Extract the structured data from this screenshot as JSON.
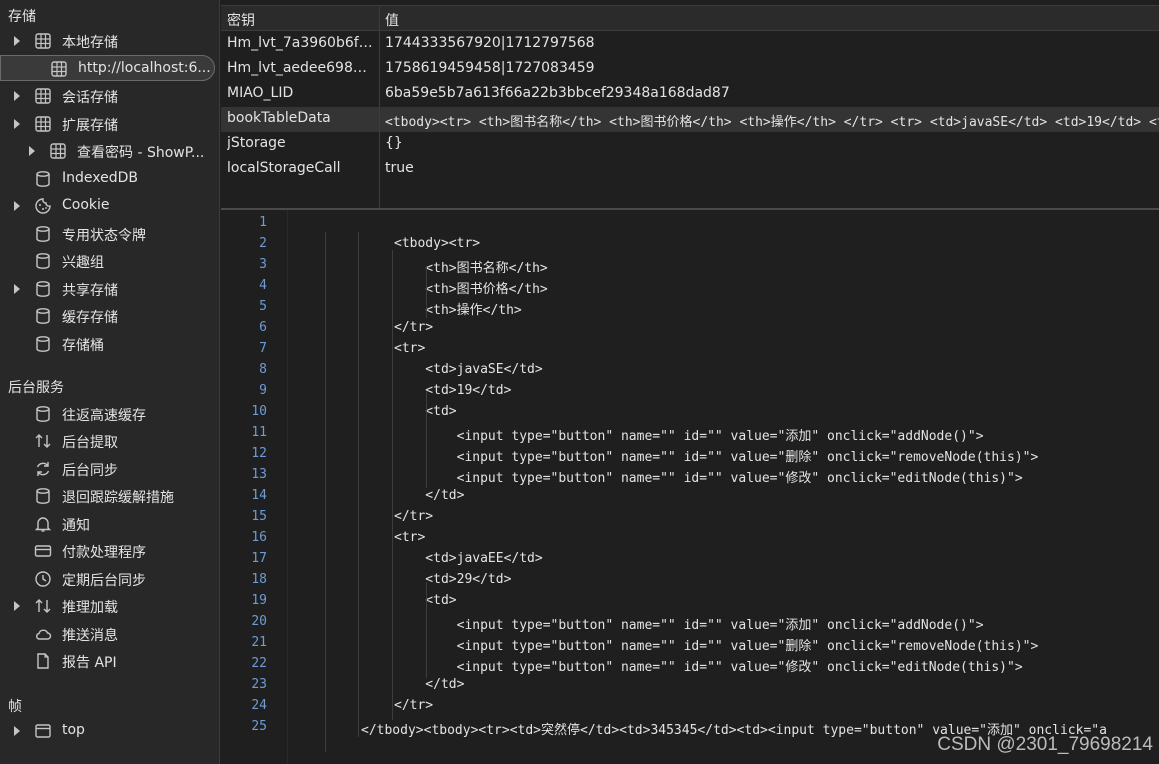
{
  "sidebar": {
    "storage_title": "存储",
    "background_title": "后台服务",
    "frames_title": "帧",
    "items": [
      {
        "label": "本地存储",
        "icon": "grid-icon",
        "expandable": true
      },
      {
        "label": "http://localhost:6...",
        "icon": "grid-icon",
        "expandable": false,
        "selected": true
      },
      {
        "label": "会话存储",
        "icon": "grid-icon",
        "expandable": true
      },
      {
        "label": "扩展存储",
        "icon": "grid-icon",
        "expandable": true
      },
      {
        "label": "查看密码 - ShowP...",
        "icon": "grid-icon",
        "expandable": true
      },
      {
        "label": "IndexedDB",
        "icon": "database-icon",
        "expandable": false
      },
      {
        "label": "Cookie",
        "icon": "cookie-icon",
        "expandable": true
      },
      {
        "label": "专用状态令牌",
        "icon": "database-icon",
        "expandable": false
      },
      {
        "label": "兴趣组",
        "icon": "database-icon",
        "expandable": false
      },
      {
        "label": "共享存储",
        "icon": "database-icon",
        "expandable": true
      },
      {
        "label": "缓存存储",
        "icon": "database-icon",
        "expandable": false
      },
      {
        "label": "存储桶",
        "icon": "database-icon",
        "expandable": false
      }
    ],
    "background_items": [
      {
        "label": "往返高速缓存",
        "icon": "database-icon"
      },
      {
        "label": "后台提取",
        "icon": "arrows-updown-icon"
      },
      {
        "label": "后台同步",
        "icon": "sync-icon"
      },
      {
        "label": "退回跟踪缓解措施",
        "icon": "database-icon"
      },
      {
        "label": "通知",
        "icon": "bell-icon"
      },
      {
        "label": "付款处理程序",
        "icon": "card-icon"
      },
      {
        "label": "定期后台同步",
        "icon": "clock-icon"
      },
      {
        "label": "推理加载",
        "icon": "arrows-updown-icon"
      },
      {
        "label": "推送消息",
        "icon": "cloud-icon"
      },
      {
        "label": "报告 API",
        "icon": "document-icon"
      }
    ],
    "frames": [
      {
        "label": "top",
        "icon": "window-icon"
      }
    ]
  },
  "table": {
    "col_key": "密钥",
    "col_value": "值",
    "rows": [
      {
        "key": "Hm_lvt_7a3960b6f0...",
        "value": "1744333567920|1712797568"
      },
      {
        "key": "Hm_lvt_aedee6983d...",
        "value": "1758619459458|1727083459"
      },
      {
        "key": "MIAO_LID",
        "value": "6ba59e5b7a613f66a22b3bbcef29348a168dad87"
      },
      {
        "key": "bookTableData",
        "value": "<tbody><tr> <th>图书名称</th> <th>图书价格</th> <th>操作</th> </tr> <tr> <td>javaSE</td> <td>19</td> <td>"
      },
      {
        "key": "jStorage",
        "value": "{}"
      },
      {
        "key": "localStorageCall",
        "value": "true"
      }
    ]
  },
  "code": {
    "lines": [
      "",
      "<tbody><tr>",
      "    <th>图书名称</th>",
      "    <th>图书价格</th>",
      "    <th>操作</th>",
      "</tr>",
      "<tr>",
      "    <td>javaSE</td>",
      "    <td>19</td>",
      "    <td>",
      "        <input type=\"button\" name=\"\" id=\"\" value=\"添加\" onclick=\"addNode()\">",
      "        <input type=\"button\" name=\"\" id=\"\" value=\"删除\" onclick=\"removeNode(this)\">",
      "        <input type=\"button\" name=\"\" id=\"\" value=\"修改\" onclick=\"editNode(this)\">",
      "    </td>",
      "</tr>",
      "<tr>",
      "    <td>javaEE</td>",
      "    <td>29</td>",
      "    <td>",
      "        <input type=\"button\" name=\"\" id=\"\" value=\"添加\" onclick=\"addNode()\">",
      "        <input type=\"button\" name=\"\" id=\"\" value=\"删除\" onclick=\"removeNode(this)\">",
      "        <input type=\"button\" name=\"\" id=\"\" value=\"修改\" onclick=\"editNode(this)\">",
      "    </td>",
      "</tr>",
      "</tbody><tbody><tr><td>突然停</td><td>345345</td><td><input type=\"button\" value=\"添加\" onclick=\"a"
    ]
  },
  "watermark": "CSDN @2301_79698214"
}
